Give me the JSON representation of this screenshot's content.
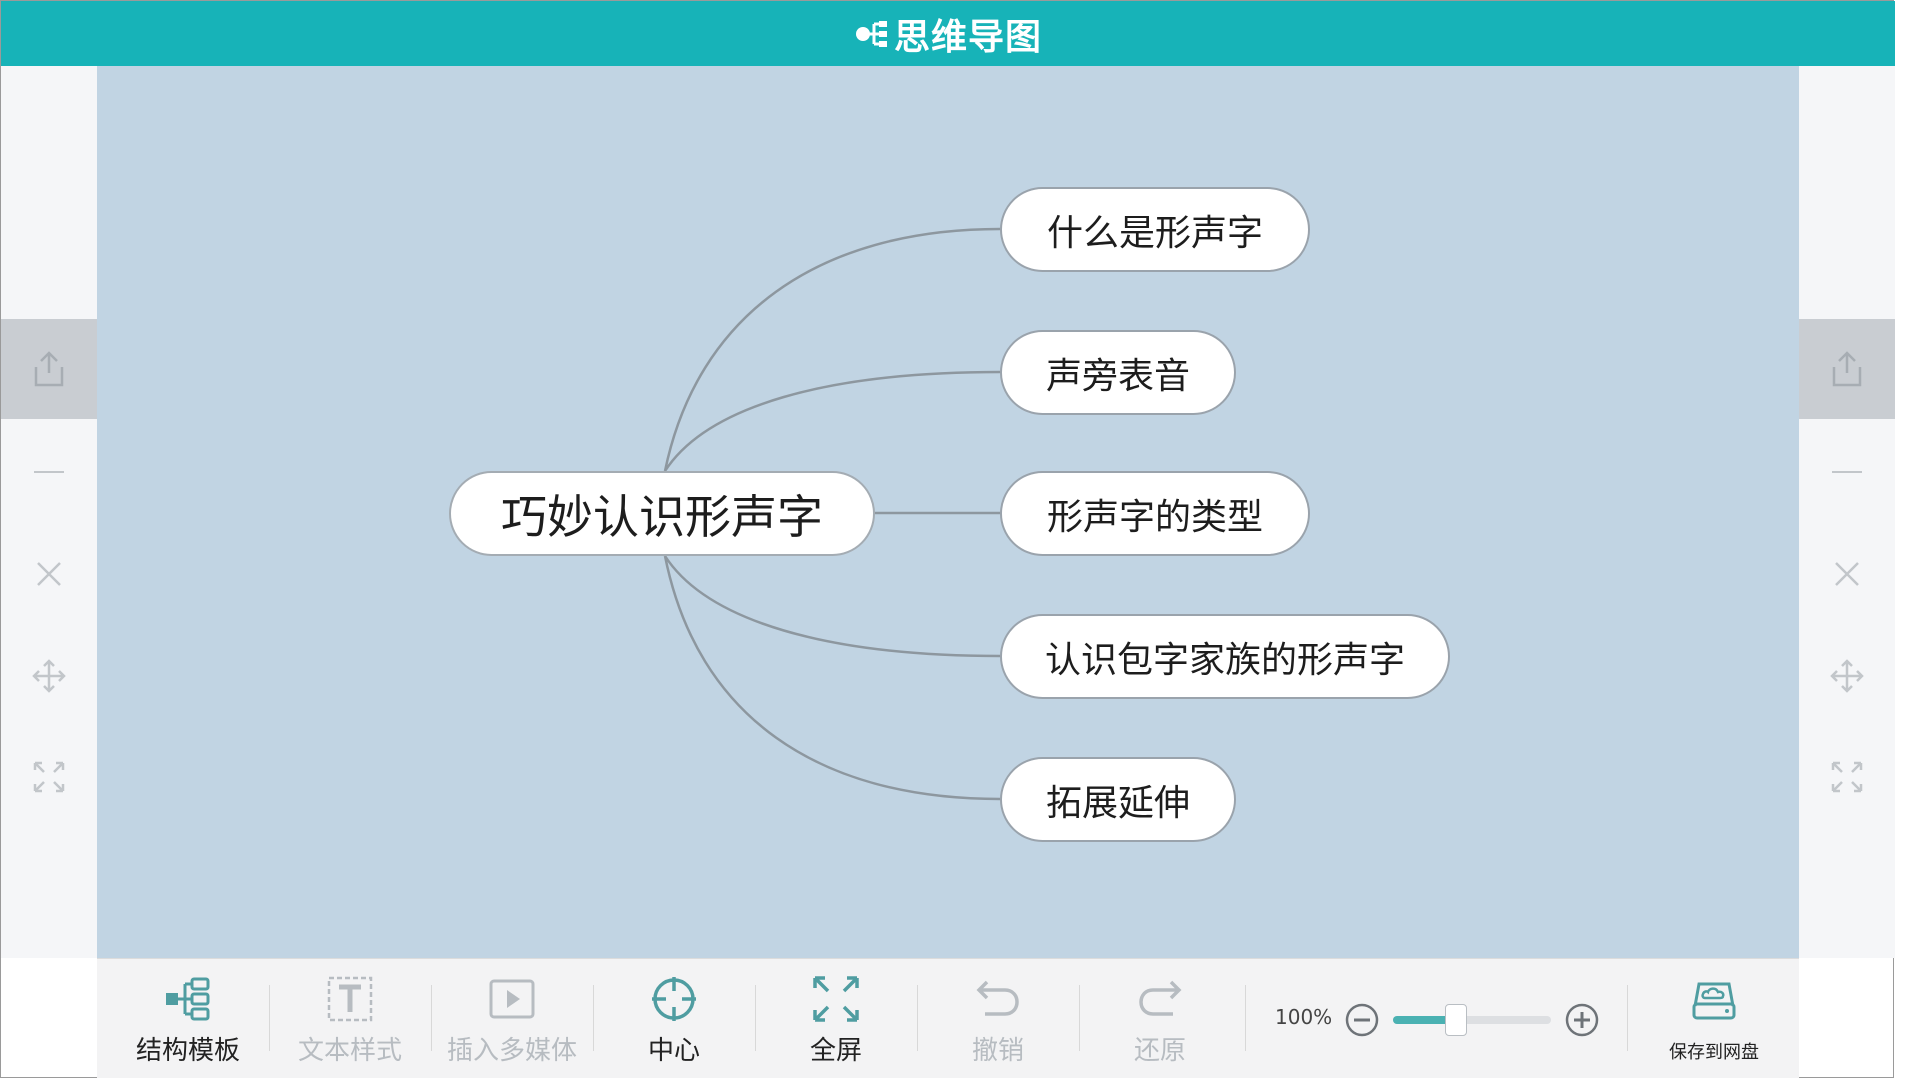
{
  "app": {
    "title": "思维导图"
  },
  "mindmap": {
    "root": "巧妙认识形声字",
    "children": [
      {
        "label": "什么是形声字"
      },
      {
        "label": "声旁表音"
      },
      {
        "label": "形声字的类型"
      },
      {
        "label": "认识包字家族的形声字"
      },
      {
        "label": "拓展延伸"
      }
    ]
  },
  "side_tools": [
    "share-icon",
    "minus-icon",
    "close-icon",
    "move-icon",
    "expand-icon"
  ],
  "toolbar": {
    "items": [
      {
        "label": "结构模板",
        "icon": "structure-icon",
        "enabled": true
      },
      {
        "label": "文本样式",
        "icon": "text-style-icon",
        "enabled": false
      },
      {
        "label": "插入多媒体",
        "icon": "media-icon",
        "enabled": false
      },
      {
        "label": "中心",
        "icon": "center-icon",
        "enabled": true
      },
      {
        "label": "全屏",
        "icon": "fullscreen-icon",
        "enabled": true
      },
      {
        "label": "撤销",
        "icon": "undo-icon",
        "enabled": false
      },
      {
        "label": "还原",
        "icon": "redo-icon",
        "enabled": false
      }
    ],
    "zoom": {
      "label": "100%",
      "level": 0.4
    },
    "save": {
      "label": "保存到网盘",
      "icon": "cloud-drive-icon"
    }
  },
  "colors": {
    "header": "#17b3b8",
    "canvas": "#c1d4e3",
    "rail": "#f5f6f8",
    "accent": "#4ab1b2",
    "connector": "#8d979f"
  }
}
